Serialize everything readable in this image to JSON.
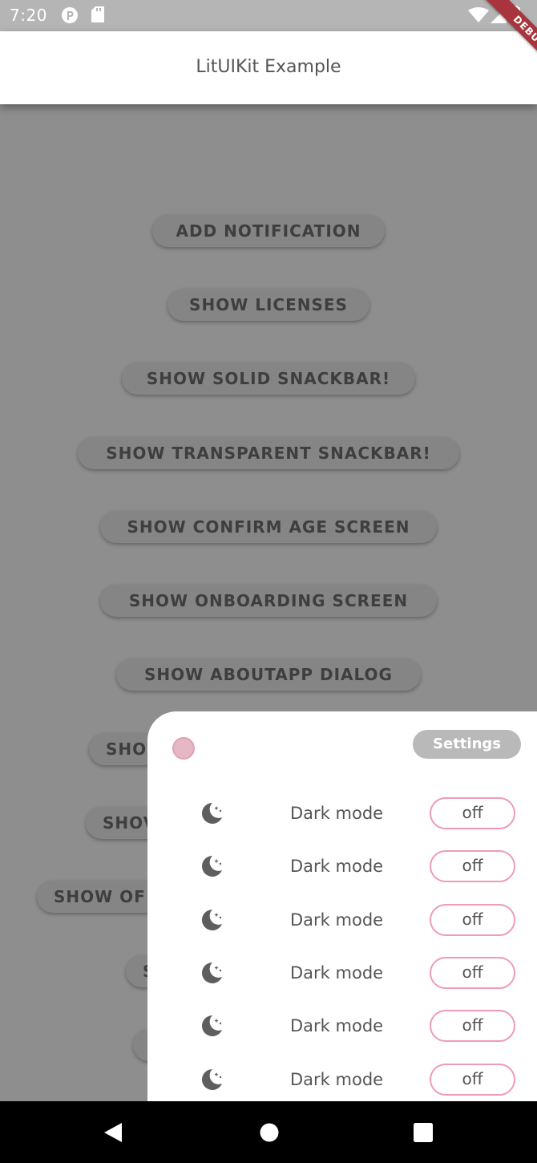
{
  "status_bar": {
    "time": "7:20",
    "icons": [
      "p-notification-icon",
      "sd-card-icon",
      "wifi-icon",
      "cell-signal-icon",
      "battery-icon"
    ]
  },
  "debug_banner": {
    "label": "DEBUG",
    "color": "#a8353d"
  },
  "app_bar": {
    "title": "LitUIKit Example"
  },
  "main": {
    "buttons": [
      {
        "label": "ADD NOTIFICATION"
      },
      {
        "label": "SHOW LICENSES"
      },
      {
        "label": "SHOW SOLID SNACKBAR!"
      },
      {
        "label": "SHOW TRANSPARENT SNACKBAR!"
      },
      {
        "label": "SHOW CONFIRM AGE SCREEN"
      },
      {
        "label": "SHOW ONBOARDING SCREEN"
      },
      {
        "label": "SHOW ABOUTAPP DIALOG"
      },
      {
        "label": "SHO"
      },
      {
        "label": "SHOV"
      },
      {
        "label": "SHOW OF"
      },
      {
        "label": "S"
      },
      {
        "label": ""
      }
    ]
  },
  "sheet": {
    "settings_label": "Settings",
    "rows": [
      {
        "icon": "moon-icon",
        "label": "Dark mode",
        "value": "off"
      },
      {
        "icon": "moon-icon",
        "label": "Dark mode",
        "value": "off"
      },
      {
        "icon": "moon-icon",
        "label": "Dark mode",
        "value": "off"
      },
      {
        "icon": "moon-icon",
        "label": "Dark mode",
        "value": "off"
      },
      {
        "icon": "moon-icon",
        "label": "Dark mode",
        "value": "off"
      },
      {
        "icon": "moon-icon",
        "label": "Dark mode",
        "value": "off"
      }
    ]
  },
  "colors": {
    "overlay_background": "#8e8e8e",
    "accent_pink": "#ef9bb3",
    "dot_pink": "#e6b7c4",
    "chip_grey": "#b9b9b9"
  },
  "nav_bar": {
    "icons": [
      "back-icon",
      "home-icon",
      "recents-icon"
    ]
  }
}
